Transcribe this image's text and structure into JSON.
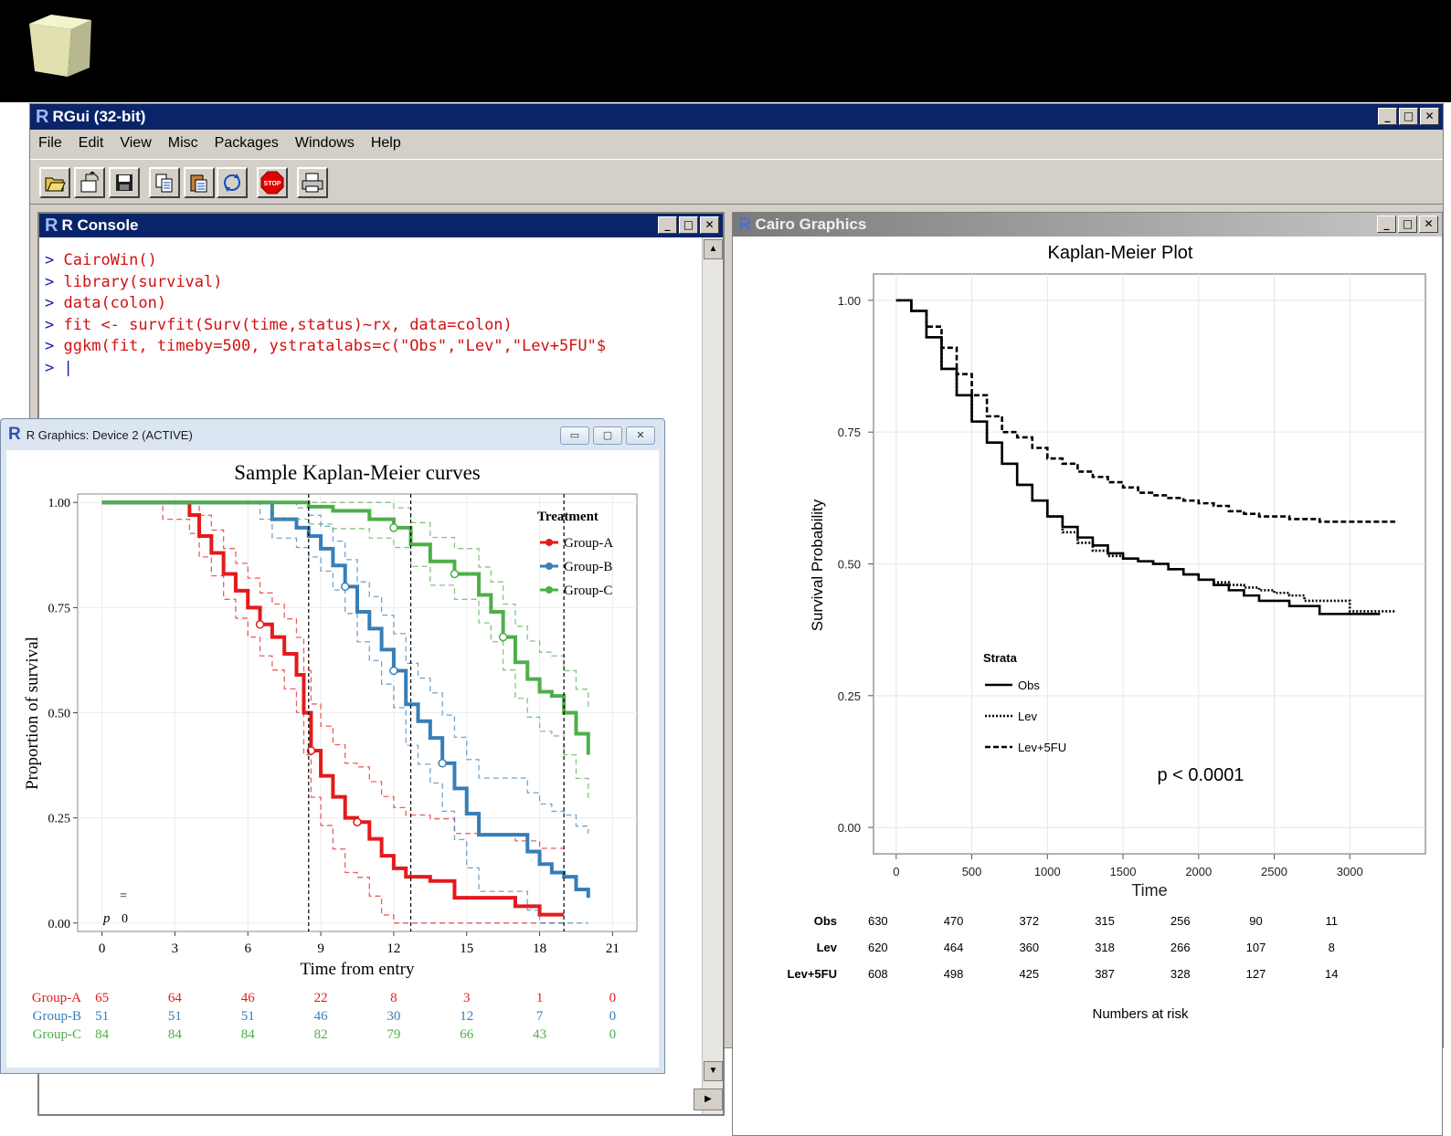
{
  "rgui": {
    "title": "RGui (32-bit)",
    "menu": [
      "File",
      "Edit",
      "View",
      "Misc",
      "Packages",
      "Windows",
      "Help"
    ],
    "toolbar_icons": [
      "open-script-icon",
      "load-workspace-icon",
      "save-icon",
      "copy-icon",
      "paste-icon",
      "refresh-icon",
      "stop-icon",
      "print-icon"
    ]
  },
  "console": {
    "title": "R Console",
    "prompt": ">",
    "lines": [
      "CairoWin()",
      "library(survival)",
      "data(colon)",
      "fit <- survfit(Surv(time,status)~rx, data=colon)",
      "ggkm(fit, timeby=500, ystratalabs=c(\"Obs\",\"Lev\",\"Lev+5FU\"$",
      ""
    ]
  },
  "cairo": {
    "title": "Cairo Graphics",
    "chart_data": {
      "type": "line",
      "title": "Kaplan-Meier Plot",
      "xlabel": "Time",
      "ylabel": "Survival Probability",
      "xlim": [
        -150,
        3500
      ],
      "ylim": [
        -0.05,
        1.05
      ],
      "xticks": [
        "0",
        "500",
        "1000",
        "1500",
        "2000",
        "2500",
        "3000"
      ],
      "yticks": [
        "0.00",
        "0.25",
        "0.50",
        "0.75",
        "1.00"
      ],
      "grid": true,
      "legend_title": "Strata",
      "legend_position": "bottom-left",
      "annotation": "p < 0.0001",
      "series": [
        {
          "name": "Obs",
          "style": "solid",
          "x": [
            0,
            100,
            200,
            300,
            400,
            500,
            600,
            700,
            800,
            900,
            1000,
            1100,
            1200,
            1300,
            1400,
            1500,
            1600,
            1700,
            1800,
            1900,
            2000,
            2100,
            2200,
            2300,
            2400,
            2500,
            2600,
            2700,
            2800,
            2900,
            3000,
            3200
          ],
          "y": [
            1.0,
            0.98,
            0.93,
            0.87,
            0.82,
            0.77,
            0.73,
            0.69,
            0.65,
            0.62,
            0.59,
            0.57,
            0.55,
            0.535,
            0.52,
            0.51,
            0.505,
            0.5,
            0.49,
            0.48,
            0.47,
            0.46,
            0.45,
            0.44,
            0.43,
            0.43,
            0.42,
            0.42,
            0.405,
            0.405,
            0.405,
            0.405
          ]
        },
        {
          "name": "Lev",
          "style": "dotted",
          "x": [
            0,
            100,
            200,
            300,
            400,
            500,
            600,
            700,
            800,
            900,
            1000,
            1100,
            1200,
            1300,
            1400,
            1500,
            1600,
            1700,
            1800,
            1900,
            2000,
            2100,
            2200,
            2300,
            2400,
            2500,
            2600,
            2700,
            2800,
            2900,
            3000,
            3300
          ],
          "y": [
            1.0,
            0.98,
            0.93,
            0.87,
            0.82,
            0.77,
            0.73,
            0.69,
            0.65,
            0.62,
            0.59,
            0.56,
            0.54,
            0.525,
            0.515,
            0.51,
            0.505,
            0.5,
            0.49,
            0.48,
            0.47,
            0.465,
            0.46,
            0.455,
            0.45,
            0.445,
            0.44,
            0.43,
            0.43,
            0.43,
            0.41,
            0.41
          ]
        },
        {
          "name": "Lev+5FU",
          "style": "dashed",
          "x": [
            0,
            100,
            200,
            300,
            400,
            500,
            600,
            700,
            800,
            900,
            1000,
            1100,
            1200,
            1300,
            1400,
            1500,
            1600,
            1700,
            1800,
            1900,
            2000,
            2100,
            2200,
            2300,
            2400,
            2500,
            2600,
            2700,
            2800,
            2900,
            3000,
            3300
          ],
          "y": [
            1.0,
            0.98,
            0.95,
            0.91,
            0.86,
            0.82,
            0.78,
            0.75,
            0.74,
            0.72,
            0.7,
            0.69,
            0.675,
            0.665,
            0.655,
            0.645,
            0.635,
            0.63,
            0.625,
            0.62,
            0.615,
            0.61,
            0.6,
            0.595,
            0.59,
            0.59,
            0.585,
            0.585,
            0.58,
            0.58,
            0.58,
            0.58
          ]
        }
      ],
      "risk_table": {
        "label": "Numbers at risk",
        "rows": [
          {
            "name": "Obs",
            "values": [
              "630",
              "470",
              "372",
              "315",
              "256",
              "90",
              "11"
            ]
          },
          {
            "name": "Lev",
            "values": [
              "620",
              "464",
              "360",
              "318",
              "266",
              "107",
              "8"
            ]
          },
          {
            "name": "Lev+5FU",
            "values": [
              "608",
              "498",
              "425",
              "387",
              "328",
              "127",
              "14"
            ]
          }
        ]
      }
    }
  },
  "device2": {
    "title": "R Graphics: Device 2 (ACTIVE)",
    "chart_data": {
      "type": "line",
      "title": "Sample Kaplan-Meier curves",
      "xlabel": "Time from entry",
      "ylabel": "Proportion of survival",
      "xlim": [
        -1,
        22
      ],
      "ylim": [
        -0.02,
        1.02
      ],
      "xticks": [
        "0",
        "3",
        "6",
        "9",
        "12",
        "15",
        "18",
        "21"
      ],
      "yticks": [
        "0.00",
        "0.25",
        "0.50",
        "0.75",
        "1.00"
      ],
      "vlines": [
        8.5,
        12.7,
        19.0
      ],
      "legend_title": "Treatment",
      "legend_position": "top-right",
      "annotation_text": [
        "=",
        "p",
        "0"
      ],
      "colors": {
        "Group-A": "#e41a1c",
        "Group-B": "#377eb8",
        "Group-C": "#4daf4a"
      },
      "series": [
        {
          "name": "Group-A",
          "x": [
            0,
            2.5,
            3.6,
            4.0,
            4.5,
            5.0,
            5.5,
            6.0,
            6.5,
            7.0,
            7.5,
            8.0,
            8.3,
            8.6,
            9.0,
            9.5,
            10.0,
            10.5,
            11.0,
            11.5,
            12.0,
            12.5,
            13.5,
            14.5,
            15.5,
            16.5,
            17.0,
            18.0,
            19.0
          ],
          "y": [
            1.0,
            1.0,
            0.97,
            0.92,
            0.88,
            0.83,
            0.79,
            0.75,
            0.71,
            0.68,
            0.64,
            0.59,
            0.5,
            0.41,
            0.35,
            0.3,
            0.25,
            0.24,
            0.2,
            0.16,
            0.13,
            0.11,
            0.1,
            0.06,
            0.06,
            0.06,
            0.04,
            0.02,
            0.02
          ]
        },
        {
          "name": "Group-B",
          "x": [
            0,
            6.5,
            7.0,
            8.0,
            8.5,
            9.0,
            9.5,
            10.0,
            10.5,
            11.0,
            11.5,
            12.0,
            12.5,
            13.0,
            13.5,
            14.0,
            14.5,
            15.0,
            15.5,
            16.5,
            17.5,
            18.0,
            18.5,
            19.0,
            19.5,
            20.0
          ],
          "y": [
            1.0,
            1.0,
            0.96,
            0.94,
            0.92,
            0.89,
            0.85,
            0.8,
            0.74,
            0.7,
            0.65,
            0.6,
            0.52,
            0.48,
            0.44,
            0.38,
            0.32,
            0.26,
            0.21,
            0.21,
            0.17,
            0.14,
            0.12,
            0.11,
            0.08,
            0.06
          ]
        },
        {
          "name": "Group-C",
          "x": [
            0,
            7.0,
            8.5,
            9.5,
            11.0,
            12.0,
            12.7,
            13.5,
            14.5,
            15.5,
            16.0,
            16.5,
            17.0,
            17.5,
            18.0,
            18.5,
            19.0,
            19.5,
            20.0
          ],
          "y": [
            1.0,
            1.0,
            0.99,
            0.98,
            0.96,
            0.94,
            0.9,
            0.86,
            0.83,
            0.78,
            0.74,
            0.68,
            0.62,
            0.58,
            0.55,
            0.54,
            0.5,
            0.45,
            0.4
          ]
        }
      ],
      "risk_table": {
        "rows": [
          {
            "name": "Group-A",
            "values": [
              "65",
              "64",
              "46",
              "22",
              "8",
              "3",
              "1",
              "0"
            ]
          },
          {
            "name": "Group-B",
            "values": [
              "51",
              "51",
              "51",
              "46",
              "30",
              "12",
              "7",
              "0"
            ]
          },
          {
            "name": "Group-C",
            "values": [
              "84",
              "84",
              "84",
              "82",
              "79",
              "66",
              "43",
              "0"
            ]
          }
        ]
      }
    }
  }
}
